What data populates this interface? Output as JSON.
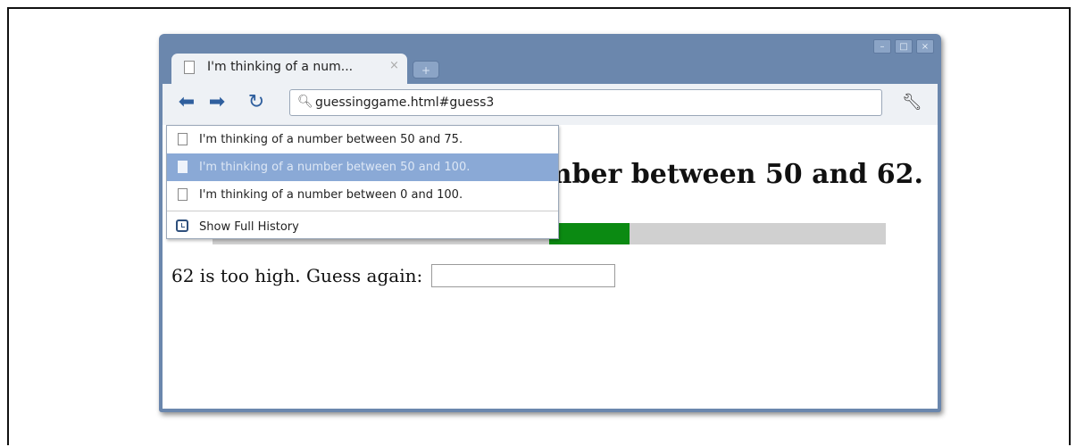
{
  "browser": {
    "tab": {
      "title": "I'm thinking of a num...",
      "close_glyph": "×"
    },
    "newtab_glyph": "+",
    "window_controls": {
      "minimize": "–",
      "maximize": "□",
      "close": "×"
    },
    "toolbar": {
      "back_icon": "back-arrow-icon",
      "forward_icon": "forward-arrow-icon",
      "reload_icon": "reload-icon",
      "search_icon": "search-icon",
      "url": "guessinggame.html#guess3",
      "menu_icon": "wrench-icon"
    }
  },
  "history_dropdown": {
    "items": [
      {
        "label": "I'm thinking of a number between 50 and 75.",
        "selected": false
      },
      {
        "label": "I'm thinking of a number between 50 and 100.",
        "selected": true
      },
      {
        "label": "I'm thinking of a number between 0 and 100.",
        "selected": false
      }
    ],
    "show_full_history": "Show Full History"
  },
  "page": {
    "heading": "I'm thinking of a number between 50 and 62.",
    "range": {
      "low": 50,
      "high": 62,
      "scale_min": 0,
      "scale_max": 100
    },
    "range_color": "#0b8a12",
    "message": "62 is too high. Guess again:",
    "guess_value": ""
  }
}
